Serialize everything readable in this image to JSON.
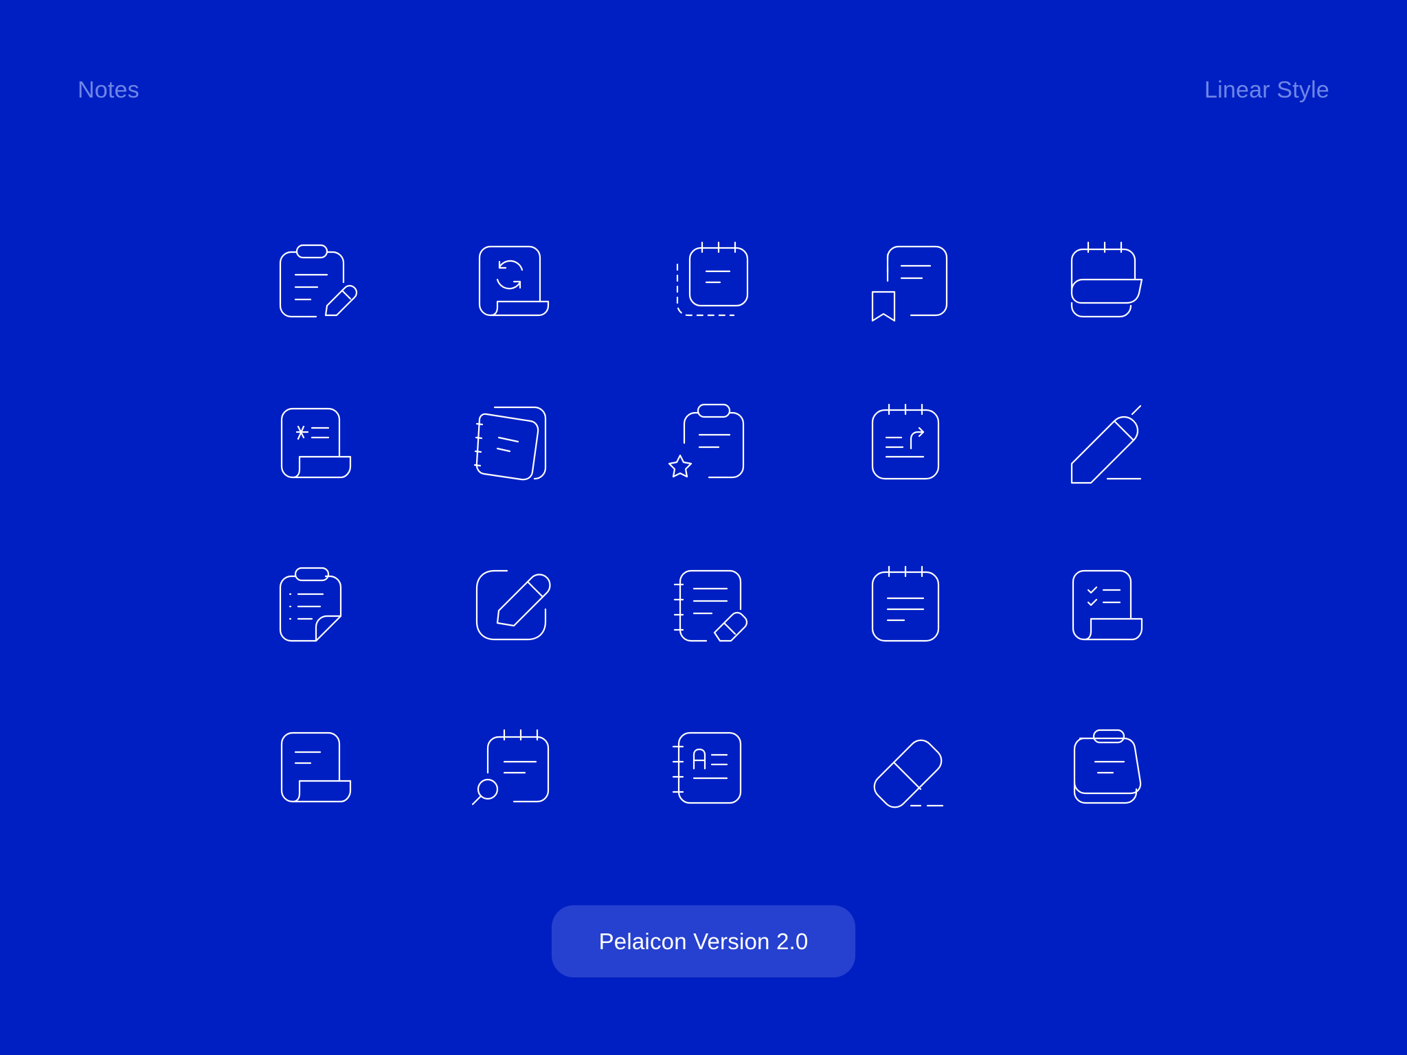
{
  "header": {
    "category_label": "Notes",
    "style_label": "Linear Style"
  },
  "icons": [
    {
      "name": "clipboard-edit-icon"
    },
    {
      "name": "note-sync-icon"
    },
    {
      "name": "notepad-dashed-copy-icon"
    },
    {
      "name": "notepad-bookmark-icon"
    },
    {
      "name": "notepad-stack-icon"
    },
    {
      "name": "note-text-scroll-icon"
    },
    {
      "name": "notebook-stack-icon"
    },
    {
      "name": "clipboard-star-icon"
    },
    {
      "name": "notepad-undo-icon"
    },
    {
      "name": "pencil-icon"
    },
    {
      "name": "clipboard-list-icon"
    },
    {
      "name": "edit-square-icon"
    },
    {
      "name": "notebook-eraser-icon"
    },
    {
      "name": "notepad-icon"
    },
    {
      "name": "note-checklist-icon"
    },
    {
      "name": "note-scroll-icon"
    },
    {
      "name": "notepad-search-icon"
    },
    {
      "name": "address-book-icon"
    },
    {
      "name": "eraser-icon"
    },
    {
      "name": "clipboard-stack-icon"
    }
  ],
  "footer": {
    "version_label": "Pelaicon Version 2.0"
  },
  "colors": {
    "background": "#001fc2",
    "muted_text": "#6f86e8",
    "pill": "#2641cf",
    "icon_stroke": "#ffffff"
  }
}
